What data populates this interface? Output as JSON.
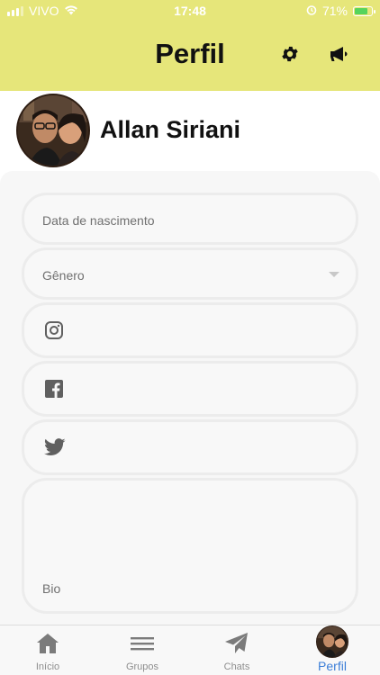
{
  "status_bar": {
    "carrier": "VIVO",
    "time": "17:48",
    "battery": "71%"
  },
  "header": {
    "title": "Perfil",
    "icons": [
      "settings-gear-icon",
      "megaphone-icon"
    ],
    "background_color": "#e6e67a"
  },
  "profile": {
    "name": "Allan Siriani"
  },
  "form": {
    "birth_date_placeholder": "Data de nascimento",
    "gender_placeholder": "Gênero",
    "instagram_icon": "instagram-icon",
    "facebook_icon": "facebook-icon",
    "twitter_icon": "twitter-icon",
    "bio_placeholder": "Bio"
  },
  "tab_bar": {
    "items": [
      {
        "label": "Início",
        "icon": "home-icon"
      },
      {
        "label": "Grupos",
        "icon": "menu-lines-icon"
      },
      {
        "label": "Chats",
        "icon": "paper-plane-icon"
      },
      {
        "label": "Perfil",
        "icon": "avatar"
      }
    ],
    "active_color": "#3d7fd8"
  }
}
